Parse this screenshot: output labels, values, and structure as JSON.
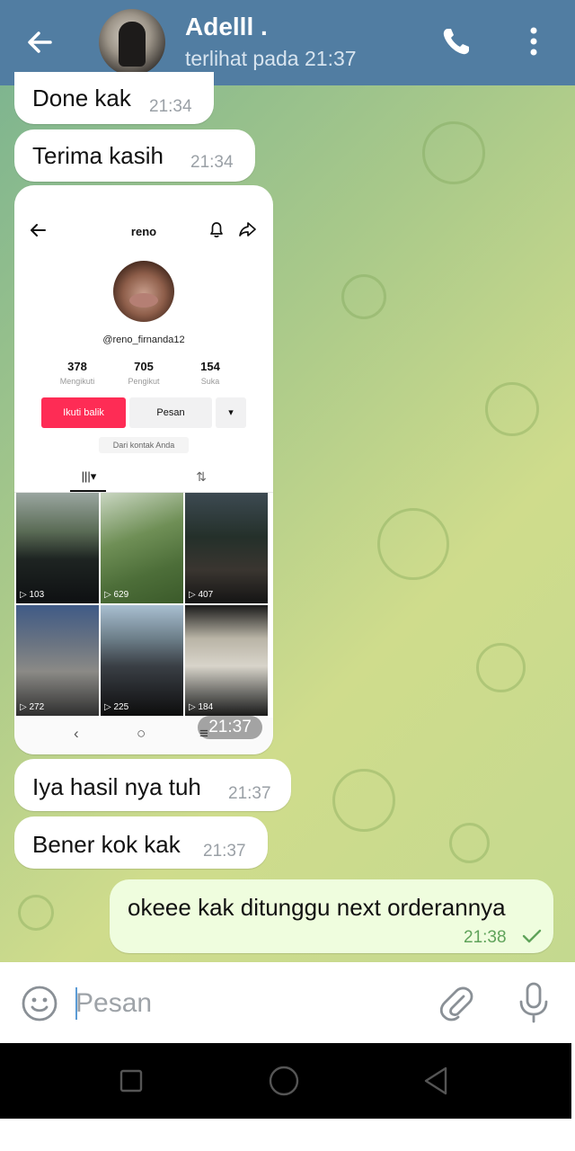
{
  "header": {
    "contact_name": "Adelll .",
    "last_seen": "terlihat pada  21:37"
  },
  "messages": [
    {
      "text": "Done kak",
      "time": "21:34"
    },
    {
      "text": "Terima kasih",
      "time": "21:34"
    },
    {
      "text": "Iya hasil nya tuh",
      "time": "21:37"
    },
    {
      "text": "Bener kok kak",
      "time": "21:37"
    },
    {
      "text": "okeee kak ditunggu next orderannya",
      "time": "21:38"
    }
  ],
  "image_message": {
    "time": "21:37",
    "profile": {
      "username": "reno",
      "handle": "@reno_firnanda12",
      "stats": [
        {
          "value": "378",
          "label": "Mengikuti"
        },
        {
          "value": "705",
          "label": "Pengikut"
        },
        {
          "value": "154",
          "label": "Suka"
        }
      ],
      "follow_label": "Ikuti balik",
      "message_label": "Pesan",
      "more_label": "▾",
      "contact_note": "Dari kontak Anda",
      "tab_grid": "|||▾",
      "tab_repost": "⇅",
      "videos": [
        "103",
        "629",
        "407",
        "272",
        "225",
        "184"
      ],
      "nav": [
        "‹",
        "○",
        "≡"
      ]
    }
  },
  "input": {
    "placeholder": "Pesan"
  },
  "colors": {
    "header": "#517da2",
    "outgoing_bubble": "#effdde",
    "tiktok_red": "#fe2c55"
  }
}
